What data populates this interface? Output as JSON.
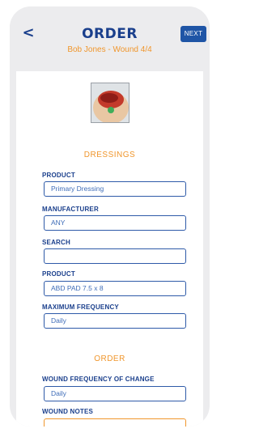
{
  "header": {
    "back_label": "<",
    "title": "ORDER",
    "subtitle": "Bob Jones - Wound 4/4",
    "next_label": "NEXT"
  },
  "dressings": {
    "heading": "DRESSINGS",
    "fields": [
      {
        "label": "PRODUCT",
        "value": "Primary Dressing"
      },
      {
        "label": "MANUFACTURER",
        "value": "ANY"
      },
      {
        "label": "SEARCH",
        "value": ""
      },
      {
        "label": "PRODUCT",
        "value": "ABD PAD 7.5 x 8"
      },
      {
        "label": "MAXIMUM FREQUENCY",
        "value": "Daily"
      }
    ]
  },
  "order": {
    "heading": "ORDER",
    "fields": [
      {
        "label": "WOUND FREQUENCY OF CHANGE",
        "value": "Daily"
      },
      {
        "label": "WOUND NOTES",
        "value": ""
      }
    ]
  },
  "colors": {
    "primary": "#1a3f8c",
    "accent": "#f0962c",
    "button": "#1f55a6"
  }
}
